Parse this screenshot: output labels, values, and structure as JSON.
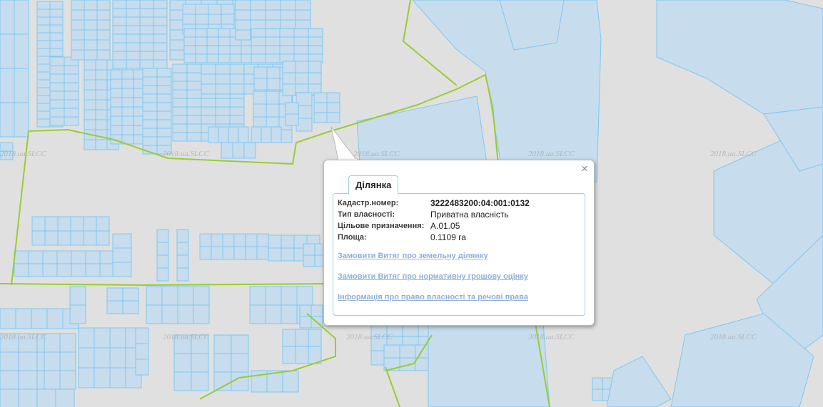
{
  "map": {
    "watermark": "2018.ua.SLCC",
    "colors": {
      "background": "#e0e0e0",
      "parcel_fill": "#c7dcec",
      "parcel_stroke": "#7fc7f2",
      "boundary": "#99cc33"
    }
  },
  "popup": {
    "close_icon": "×",
    "tab_label": "Ділянка",
    "attributes": [
      {
        "key": "Кадастр.номер:",
        "value": "3222483200:04:001:0132",
        "bold": true
      },
      {
        "key": "Тип власності:",
        "value": "Приватна власність",
        "bold": false
      },
      {
        "key": "Цільове призначення:",
        "value": "A.01.05",
        "bold": false
      },
      {
        "key": "Площа:",
        "value": "0.1109 га",
        "bold": false
      }
    ],
    "links": [
      "Замовити Витяг про земельну ділянку",
      "Замовити Витяг про нормативну грошову оцінку",
      "Інформація про право власності та речові права"
    ]
  }
}
